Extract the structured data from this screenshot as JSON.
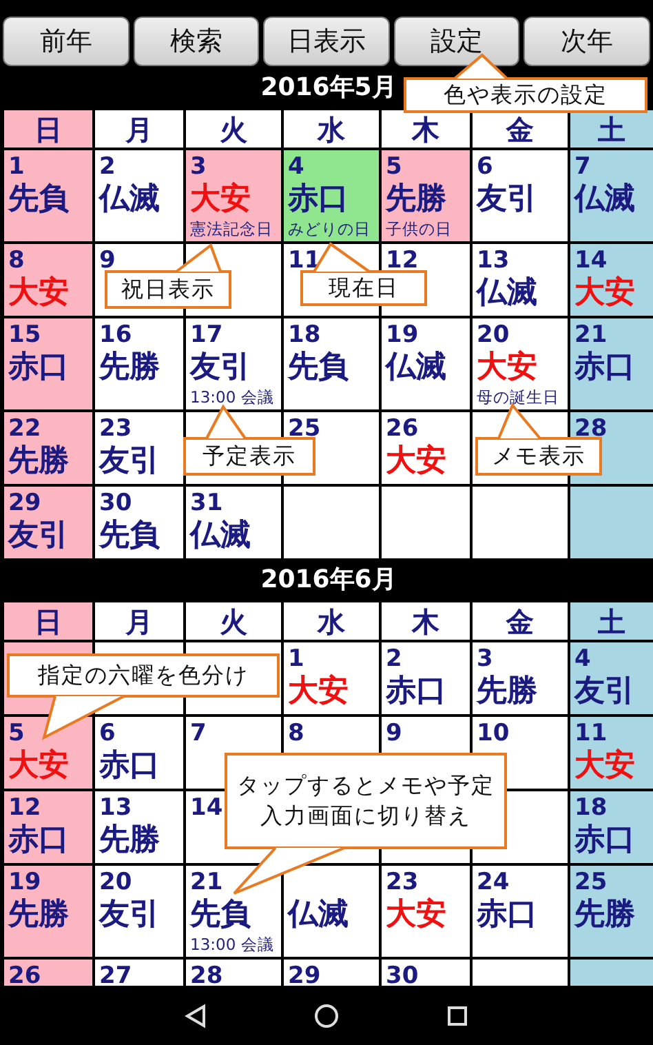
{
  "toolbar": [
    {
      "label": "前年"
    },
    {
      "label": "検索"
    },
    {
      "label": "日表示"
    },
    {
      "label": "設定"
    },
    {
      "label": "次年"
    }
  ],
  "months": [
    {
      "title": "2016年5月",
      "weekdays": [
        {
          "label": "日",
          "kind": "sunday"
        },
        {
          "label": "月",
          "kind": "weekday"
        },
        {
          "label": "火",
          "kind": "weekday"
        },
        {
          "label": "水",
          "kind": "weekday"
        },
        {
          "label": "木",
          "kind": "weekday"
        },
        {
          "label": "金",
          "kind": "weekday"
        },
        {
          "label": "土",
          "kind": "saturday"
        }
      ],
      "weeks": [
        [
          {
            "day": "1",
            "rokuyo": "先負",
            "lucky": false,
            "kind": "sunday"
          },
          {
            "day": "2",
            "rokuyo": "仏滅",
            "lucky": false,
            "kind": "weekday"
          },
          {
            "day": "3",
            "rokuyo": "大安",
            "lucky": true,
            "kind": "holiday",
            "note": "憲法記念日"
          },
          {
            "day": "4",
            "rokuyo": "赤口",
            "lucky": false,
            "kind": "today",
            "note": "みどりの日"
          },
          {
            "day": "5",
            "rokuyo": "先勝",
            "lucky": false,
            "kind": "holiday",
            "note": "子供の日"
          },
          {
            "day": "6",
            "rokuyo": "友引",
            "lucky": false,
            "kind": "weekday"
          },
          {
            "day": "7",
            "rokuyo": "仏滅",
            "lucky": false,
            "kind": "saturday"
          }
        ],
        [
          {
            "day": "8",
            "rokuyo": "大安",
            "lucky": true,
            "kind": "sunday"
          },
          {
            "day": "9",
            "kind": "weekday"
          },
          {
            "kind": "weekday"
          },
          {
            "day": "11",
            "kind": "weekday"
          },
          {
            "day": "12",
            "kind": "weekday"
          },
          {
            "day": "13",
            "rokuyo": "仏滅",
            "lucky": false,
            "kind": "weekday"
          },
          {
            "day": "14",
            "rokuyo": "大安",
            "lucky": true,
            "kind": "saturday"
          }
        ],
        [
          {
            "day": "15",
            "rokuyo": "赤口",
            "lucky": false,
            "kind": "sunday"
          },
          {
            "day": "16",
            "rokuyo": "先勝",
            "lucky": false,
            "kind": "weekday"
          },
          {
            "day": "17",
            "rokuyo": "友引",
            "lucky": false,
            "kind": "weekday",
            "note": "13:00 会議"
          },
          {
            "day": "18",
            "rokuyo": "先負",
            "lucky": false,
            "kind": "weekday"
          },
          {
            "day": "19",
            "rokuyo": "仏滅",
            "lucky": false,
            "kind": "weekday"
          },
          {
            "day": "20",
            "rokuyo": "大安",
            "lucky": true,
            "kind": "weekday",
            "note": "母の誕生日"
          },
          {
            "day": "21",
            "rokuyo": "赤口",
            "lucky": false,
            "kind": "saturday"
          }
        ],
        [
          {
            "day": "22",
            "rokuyo": "先勝",
            "lucky": false,
            "kind": "sunday"
          },
          {
            "day": "23",
            "rokuyo": "友引",
            "lucky": false,
            "kind": "weekday"
          },
          {
            "kind": "weekday"
          },
          {
            "day": "25",
            "kind": "weekday"
          },
          {
            "day": "26",
            "rokuyo": "大安",
            "lucky": true,
            "kind": "weekday"
          },
          {
            "kind": "weekday"
          },
          {
            "day": "28",
            "kind": "saturday"
          }
        ],
        [
          {
            "day": "29",
            "rokuyo": "友引",
            "lucky": false,
            "kind": "sunday"
          },
          {
            "day": "30",
            "rokuyo": "先負",
            "lucky": false,
            "kind": "weekday"
          },
          {
            "day": "31",
            "rokuyo": "仏滅",
            "lucky": false,
            "kind": "weekday"
          },
          {
            "kind": "weekday"
          },
          {
            "kind": "weekday"
          },
          {
            "kind": "weekday"
          },
          {
            "kind": "saturday"
          }
        ]
      ]
    },
    {
      "title": "2016年6月",
      "weekdays": [
        {
          "label": "日",
          "kind": "sunday"
        },
        {
          "label": "月",
          "kind": "weekday"
        },
        {
          "label": "火",
          "kind": "weekday"
        },
        {
          "label": "水",
          "kind": "weekday"
        },
        {
          "label": "木",
          "kind": "weekday"
        },
        {
          "label": "金",
          "kind": "weekday"
        },
        {
          "label": "土",
          "kind": "saturday"
        }
      ],
      "weeks": [
        [
          {
            "kind": "sunday"
          },
          {
            "kind": "weekday"
          },
          {
            "kind": "weekday"
          },
          {
            "day": "1",
            "rokuyo": "大安",
            "lucky": true,
            "kind": "weekday"
          },
          {
            "day": "2",
            "rokuyo": "赤口",
            "lucky": false,
            "kind": "weekday"
          },
          {
            "day": "3",
            "rokuyo": "先勝",
            "lucky": false,
            "kind": "weekday"
          },
          {
            "day": "4",
            "rokuyo": "友引",
            "lucky": false,
            "kind": "saturday"
          }
        ],
        [
          {
            "day": "5",
            "rokuyo": "大安",
            "lucky": true,
            "kind": "sunday"
          },
          {
            "day": "6",
            "rokuyo": "赤口",
            "lucky": false,
            "kind": "weekday"
          },
          {
            "day": "7",
            "kind": "weekday"
          },
          {
            "day": "8",
            "kind": "weekday"
          },
          {
            "day": "9",
            "kind": "weekday"
          },
          {
            "day": "10",
            "kind": "weekday"
          },
          {
            "day": "11",
            "rokuyo": "大安",
            "lucky": true,
            "kind": "saturday"
          }
        ],
        [
          {
            "day": "12",
            "rokuyo": "赤口",
            "lucky": false,
            "kind": "sunday"
          },
          {
            "day": "13",
            "rokuyo": "先勝",
            "lucky": false,
            "kind": "weekday"
          },
          {
            "day": "14",
            "kind": "weekday"
          },
          {
            "kind": "weekday"
          },
          {
            "kind": "weekday"
          },
          {
            "kind": "weekday"
          },
          {
            "day": "18",
            "rokuyo": "赤口",
            "lucky": false,
            "kind": "saturday"
          }
        ],
        [
          {
            "day": "19",
            "rokuyo": "先勝",
            "lucky": false,
            "kind": "sunday"
          },
          {
            "day": "20",
            "rokuyo": "友引",
            "lucky": false,
            "kind": "weekday"
          },
          {
            "day": "21",
            "rokuyo": "先負",
            "lucky": false,
            "kind": "weekday",
            "note": "13:00 会議"
          },
          {
            "rokuyo": "仏滅",
            "lucky": false,
            "kind": "weekday"
          },
          {
            "day": "23",
            "rokuyo": "大安",
            "lucky": true,
            "kind": "weekday"
          },
          {
            "day": "24",
            "rokuyo": "赤口",
            "lucky": false,
            "kind": "weekday"
          },
          {
            "day": "25",
            "rokuyo": "先勝",
            "lucky": false,
            "kind": "saturday"
          }
        ],
        [
          {
            "day": "26",
            "kind": "sunday"
          },
          {
            "day": "27",
            "kind": "weekday"
          },
          {
            "day": "28",
            "kind": "weekday"
          },
          {
            "day": "29",
            "kind": "weekday"
          },
          {
            "day": "30",
            "kind": "weekday"
          },
          {
            "kind": "weekday"
          },
          {
            "kind": "saturday"
          }
        ]
      ]
    }
  ],
  "callouts": [
    {
      "text": "色や表示の設定"
    },
    {
      "text": "祝日表示"
    },
    {
      "text": "現在日"
    },
    {
      "text": "予定表示"
    },
    {
      "text": "メモ表示"
    },
    {
      "text": "指定の六曜を色分け"
    },
    {
      "text": "タップするとメモや予定入力画面に切り替え"
    }
  ]
}
